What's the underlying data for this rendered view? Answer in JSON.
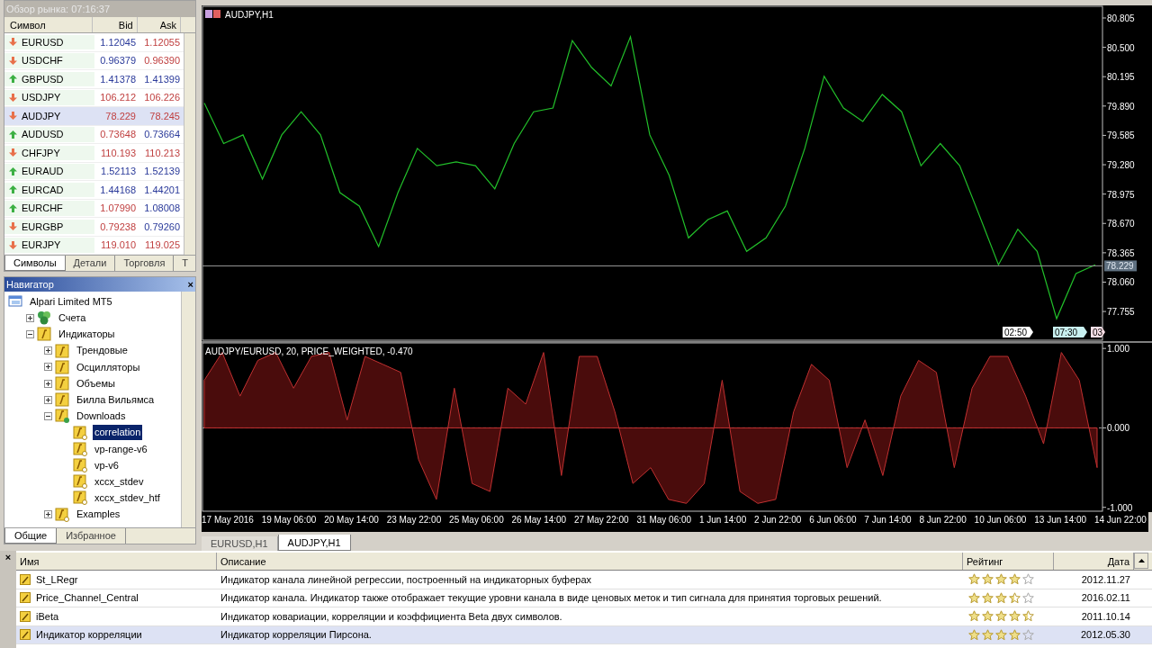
{
  "market_watch": {
    "title": "Обзор рынка: 07:16:37",
    "columns": [
      "Символ",
      "Bid",
      "Ask"
    ],
    "rows": [
      {
        "symbol": "EURUSD",
        "bid": "1.12045",
        "ask": "1.12055",
        "up": false,
        "bid_up": true,
        "ask_up": false,
        "selected": false
      },
      {
        "symbol": "USDCHF",
        "bid": "0.96379",
        "ask": "0.96390",
        "up": false,
        "bid_up": true,
        "ask_up": false,
        "selected": false
      },
      {
        "symbol": "GBPUSD",
        "bid": "1.41378",
        "ask": "1.41399",
        "up": true,
        "bid_up": true,
        "ask_up": true,
        "selected": false
      },
      {
        "symbol": "USDJPY",
        "bid": "106.212",
        "ask": "106.226",
        "up": false,
        "bid_up": false,
        "ask_up": false,
        "selected": false
      },
      {
        "symbol": "AUDJPY",
        "bid": "78.229",
        "ask": "78.245",
        "up": false,
        "bid_up": false,
        "ask_up": false,
        "selected": true
      },
      {
        "symbol": "AUDUSD",
        "bid": "0.73648",
        "ask": "0.73664",
        "up": true,
        "bid_up": false,
        "ask_up": true,
        "selected": false
      },
      {
        "symbol": "CHFJPY",
        "bid": "110.193",
        "ask": "110.213",
        "up": false,
        "bid_up": false,
        "ask_up": false,
        "selected": false
      },
      {
        "symbol": "EURAUD",
        "bid": "1.52113",
        "ask": "1.52139",
        "up": true,
        "bid_up": true,
        "ask_up": true,
        "selected": false
      },
      {
        "symbol": "EURCAD",
        "bid": "1.44168",
        "ask": "1.44201",
        "up": true,
        "bid_up": true,
        "ask_up": true,
        "selected": false
      },
      {
        "symbol": "EURCHF",
        "bid": "1.07990",
        "ask": "1.08008",
        "up": true,
        "bid_up": false,
        "ask_up": true,
        "selected": false
      },
      {
        "symbol": "EURGBP",
        "bid": "0.79238",
        "ask": "0.79260",
        "up": false,
        "bid_up": false,
        "ask_up": true,
        "selected": false
      },
      {
        "symbol": "EURJPY",
        "bid": "119.010",
        "ask": "119.025",
        "up": false,
        "bid_up": false,
        "ask_up": false,
        "selected": false
      }
    ],
    "tabs": [
      {
        "label": "Символы",
        "selected": true
      },
      {
        "label": "Детали",
        "selected": false
      },
      {
        "label": "Торговля",
        "selected": false
      },
      {
        "label": "Т",
        "selected": false
      }
    ]
  },
  "navigator": {
    "title": "Навигатор",
    "close": "×",
    "tree": [
      {
        "label": "Alpari Limited MT5",
        "kind": "terminal",
        "selected": false,
        "children": [
          {
            "label": "Счета",
            "kind": "accounts",
            "expanded": false,
            "selected": false
          },
          {
            "label": "Индикаторы",
            "kind": "folder",
            "expanded": true,
            "selected": false,
            "children": [
              {
                "label": "Трендовые",
                "kind": "folder",
                "expanded": false,
                "selected": false
              },
              {
                "label": "Осцилляторы",
                "kind": "folder",
                "expanded": false,
                "selected": false
              },
              {
                "label": "Объемы",
                "kind": "folder",
                "expanded": false,
                "selected": false
              },
              {
                "label": "Билла Вильямса",
                "kind": "folder",
                "expanded": false,
                "selected": false
              },
              {
                "label": "Downloads",
                "kind": "download",
                "expanded": true,
                "selected": false,
                "children": [
                  {
                    "label": "correlation",
                    "kind": "indicator",
                    "selected": true
                  },
                  {
                    "label": "vp-range-v6",
                    "kind": "indicator",
                    "selected": false
                  },
                  {
                    "label": "vp-v6",
                    "kind": "indicator",
                    "selected": false
                  },
                  {
                    "label": "xccx_stdev",
                    "kind": "indicator",
                    "selected": false
                  },
                  {
                    "label": "xccx_stdev_htf",
                    "kind": "indicator",
                    "selected": false
                  }
                ]
              },
              {
                "label": "Examples",
                "kind": "indicator",
                "expanded": false,
                "selected": false
              }
            ]
          }
        ]
      }
    ],
    "tabs": [
      {
        "label": "Общие",
        "selected": true
      },
      {
        "label": "Избранное",
        "selected": false
      }
    ]
  },
  "chart": {
    "title": "AUDJPY,H1",
    "time_markers": [
      {
        "label": "02:50",
        "kind": "plain"
      },
      {
        "label": "07:30",
        "kind": "cursor"
      },
      {
        "label": "03",
        "kind": "end"
      }
    ],
    "chart_data": {
      "type": "line",
      "ylim": [
        77.466,
        80.917
      ],
      "ref_lines": [
        {
          "axis": "y",
          "value": 78.229,
          "label": "78.229"
        }
      ],
      "yticks": [
        {
          "value": 80.805,
          "label": "80.805"
        },
        {
          "value": 80.5,
          "label": "80.500"
        },
        {
          "value": 80.195,
          "label": "80.195"
        },
        {
          "value": 79.89,
          "label": "79.890"
        },
        {
          "value": 79.585,
          "label": "79.585"
        },
        {
          "value": 79.28,
          "label": "79.280"
        },
        {
          "value": 78.975,
          "label": "78.975"
        },
        {
          "value": 78.67,
          "label": "78.670"
        },
        {
          "value": 78.365,
          "label": "78.365"
        },
        {
          "value": 78.06,
          "label": "78.060"
        },
        {
          "value": 77.755,
          "label": "77.755"
        }
      ],
      "series": [
        {
          "color": "#22c02a",
          "values": [
            79.92,
            79.5,
            79.59,
            79.13,
            79.59,
            79.83,
            79.59,
            78.99,
            78.85,
            78.43,
            78.99,
            79.45,
            79.27,
            79.31,
            79.27,
            79.03,
            79.5,
            79.83,
            79.87,
            80.57,
            80.29,
            80.1,
            80.61,
            79.59,
            79.17,
            78.52,
            78.71,
            78.8,
            78.38,
            78.52,
            78.85,
            79.45,
            80.2,
            79.87,
            79.73,
            80.01,
            79.83,
            79.27,
            79.5,
            79.27,
            78.76,
            78.24,
            78.61,
            78.38,
            77.68,
            78.15,
            78.24
          ]
        }
      ]
    }
  },
  "indicator": {
    "label": "AUDJPY/EURUSD, 20, PRICE_WEIGHTED, -0.470",
    "chart_data": {
      "type": "area",
      "ylim": [
        -1.06,
        1.07
      ],
      "yticks": [
        {
          "value": 1,
          "label": "1.000"
        },
        {
          "value": 0,
          "label": "0.000"
        },
        {
          "value": -1,
          "label": "-1.000"
        }
      ],
      "series": [
        {
          "color": "#c03030",
          "values": [
            0.6,
            0.95,
            0.4,
            0.85,
            0.95,
            0.5,
            0.9,
            0.95,
            0.1,
            0.9,
            0.8,
            0.7,
            -0.4,
            -0.9,
            0.5,
            -0.7,
            -0.8,
            0.5,
            0.3,
            0.95,
            -0.6,
            0.9,
            0.9,
            0.2,
            -0.7,
            -0.5,
            -0.9,
            -0.95,
            -0.7,
            0.6,
            -0.8,
            -0.95,
            -0.9,
            0.2,
            0.8,
            0.6,
            -0.5,
            0.1,
            -0.6,
            0.4,
            0.85,
            0.7,
            -0.5,
            0.5,
            0.9,
            0.9,
            0.4,
            -0.2,
            0.95,
            0.6,
            -0.5
          ]
        }
      ]
    }
  },
  "time_axis": [
    "17 May 2016",
    "19 May 06:00",
    "20 May 14:00",
    "23 May 22:00",
    "25 May 06:00",
    "26 May 14:00",
    "27 May 22:00",
    "31 May 06:00",
    "1 Jun 14:00",
    "2 Jun 22:00",
    "6 Jun 06:00",
    "7 Jun 14:00",
    "8 Jun 22:00",
    "10 Jun 06:00",
    "13 Jun 14:00",
    "14 Jun 22:00"
  ],
  "chart_tabs": [
    {
      "label": "EURUSD,H1",
      "selected": false
    },
    {
      "label": "AUDJPY,H1",
      "selected": true
    }
  ],
  "library": {
    "close": "×",
    "columns": [
      "Имя",
      "Описание",
      "Рейтинг",
      "Дата"
    ],
    "rows": [
      {
        "name": "St_LRegr",
        "description": "Индикатор канала линейной регрессии, построенный на индикаторных буферах",
        "stars": 4,
        "date": "2012.11.27",
        "selected": false
      },
      {
        "name": "Price_Channel_Central",
        "description": "Индикатор канала. Индикатор также отображает текущие уровни канала в виде ценовых меток и тип сигнала для принятия торговых решений.",
        "stars": 3.5,
        "date": "2016.02.11",
        "selected": false
      },
      {
        "name": "iBeta",
        "description": "Индикатор ковариации, корреляции и коэффициента Beta двух символов.",
        "stars": 4.5,
        "date": "2011.10.14",
        "selected": false
      },
      {
        "name": "Индикатор корреляции",
        "description": "Индикатор корреляции Пирсона.",
        "stars": 4,
        "date": "2012.05.30",
        "selected": true
      }
    ]
  }
}
